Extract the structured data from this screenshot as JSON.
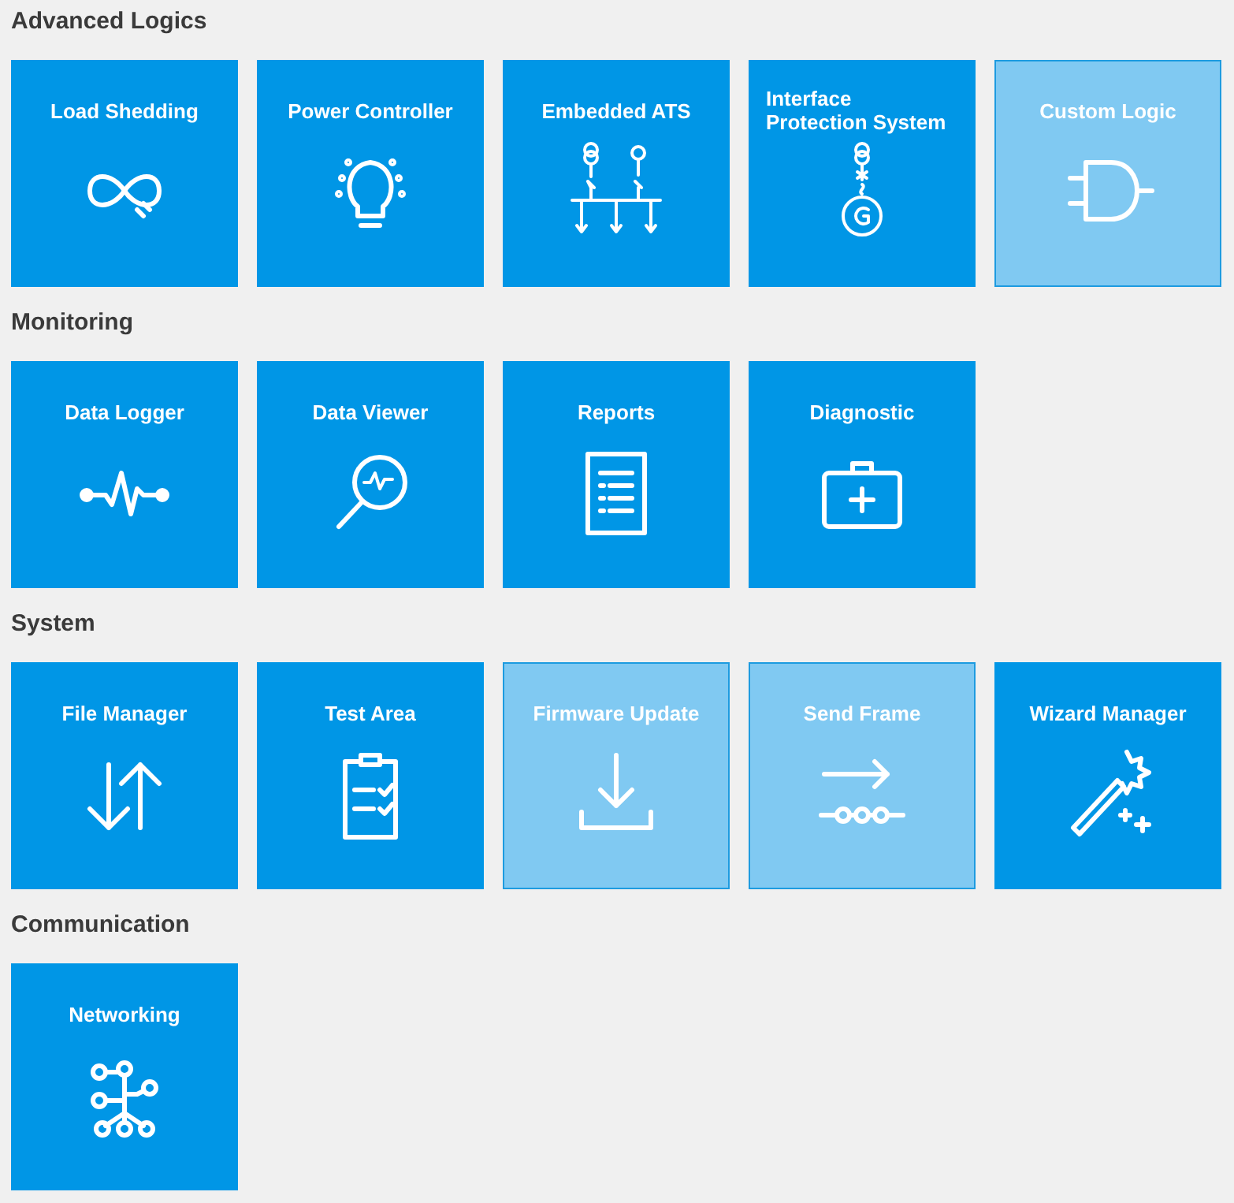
{
  "sections": [
    {
      "title": "Advanced Logics",
      "tiles": [
        {
          "label": "Load Shedding",
          "kind": "infinity",
          "disabled": false
        },
        {
          "label": "Power Controller",
          "kind": "bulb",
          "disabled": false
        },
        {
          "label": "Embedded ATS",
          "kind": "ats",
          "disabled": false
        },
        {
          "label": "Interface Protection System",
          "kind": "generator",
          "disabled": false
        },
        {
          "label": "Custom Logic",
          "kind": "gate",
          "disabled": true
        }
      ]
    },
    {
      "title": "Monitoring",
      "tiles": [
        {
          "label": "Data Logger",
          "kind": "pulse",
          "disabled": false
        },
        {
          "label": "Data Viewer",
          "kind": "magnifier",
          "disabled": false
        },
        {
          "label": "Reports",
          "kind": "document",
          "disabled": false
        },
        {
          "label": "Diagnostic",
          "kind": "medkit",
          "disabled": false
        }
      ]
    },
    {
      "title": "System",
      "tiles": [
        {
          "label": "File Manager",
          "kind": "arrows",
          "disabled": false
        },
        {
          "label": "Test Area",
          "kind": "clipboard",
          "disabled": false
        },
        {
          "label": "Firmware Update",
          "kind": "download",
          "disabled": true
        },
        {
          "label": "Send Frame",
          "kind": "frame",
          "disabled": true
        },
        {
          "label": "Wizard Manager",
          "kind": "wand",
          "disabled": false
        }
      ]
    },
    {
      "title": "Communication",
      "tiles": [
        {
          "label": "Networking",
          "kind": "network",
          "disabled": false
        }
      ]
    }
  ]
}
